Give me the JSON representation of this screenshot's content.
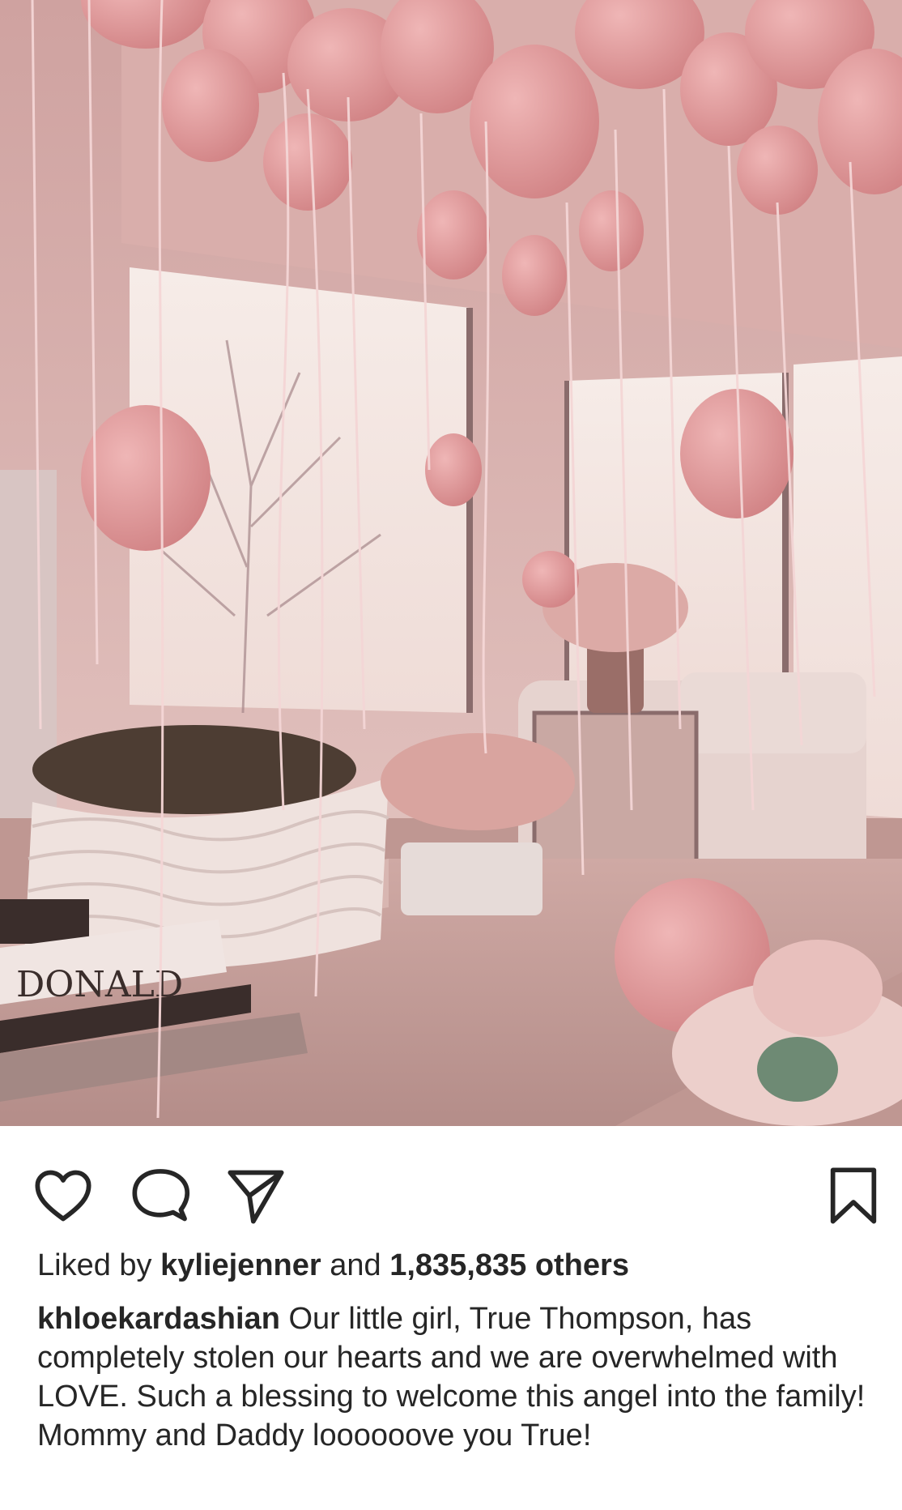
{
  "post": {
    "image_alt": "Living room filled with pink balloons, flowers and a stuffed animal",
    "liked_by_prefix": "Liked by",
    "liked_by_user": "kyliejenner",
    "liked_by_joiner": "and",
    "likes_others": "1,835,835 others",
    "caption_user": "khloekardashian",
    "caption_text": "Our little girl, True Thompson, has completely stolen our hearts and we are overwhelmed with LOVE. Such a blessing to welcome this angel into the family! Mommy and Daddy loooooove you True!",
    "photo_book_text": "DONALD"
  },
  "actions": {
    "like_icon": "heart-icon",
    "comment_icon": "comment-bubble-icon",
    "share_icon": "paper-plane-icon",
    "save_icon": "bookmark-icon"
  },
  "colors": {
    "text": "#262626",
    "balloon": "#e29a9c",
    "background": "#ffffff"
  }
}
